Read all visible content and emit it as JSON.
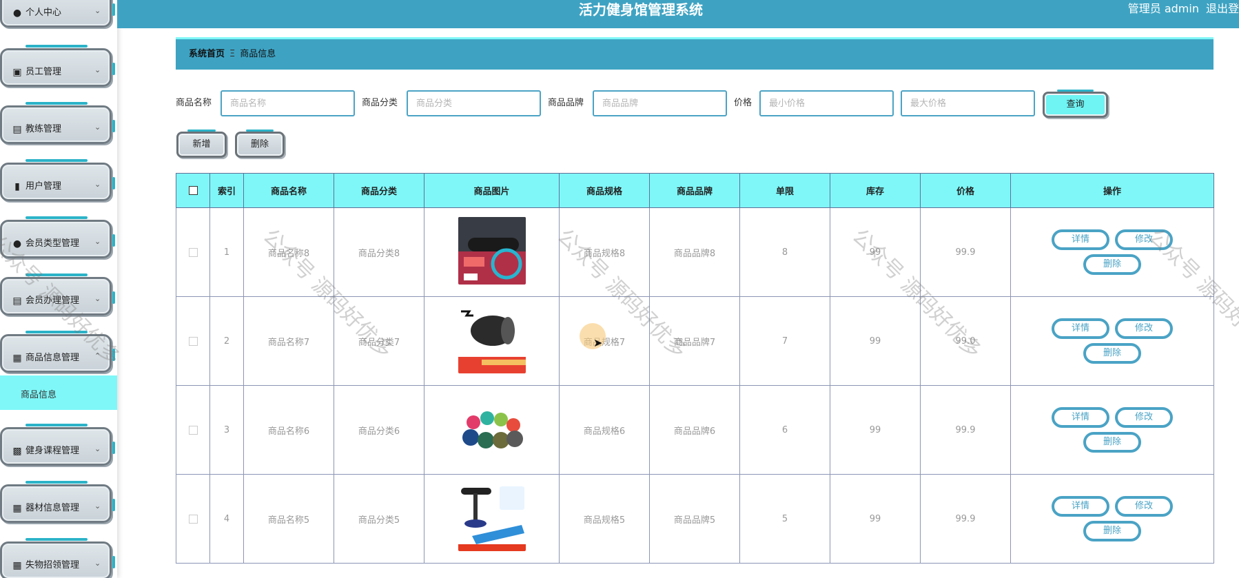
{
  "header": {
    "title": "活力健身馆管理系统",
    "user_label": "管理员 admin",
    "logout_label": "退出登"
  },
  "sidebar": {
    "items": [
      {
        "label": "个人中心",
        "icon": "person-icon"
      },
      {
        "label": "员工管理",
        "icon": "inbox-icon"
      },
      {
        "label": "教练管理",
        "icon": "briefcase-icon"
      },
      {
        "label": "用户管理",
        "icon": "bar-chart-icon"
      },
      {
        "label": "会员类型管理",
        "icon": "person-icon"
      },
      {
        "label": "会员办理管理",
        "icon": "document-icon"
      },
      {
        "label": "商品信息管理",
        "icon": "grid-icon"
      },
      {
        "label": "健身课程管理",
        "icon": "monitor-icon"
      },
      {
        "label": "器材信息管理",
        "icon": "grid-icon"
      },
      {
        "label": "失物招领管理",
        "icon": "grid-icon"
      }
    ],
    "active_sub": "商品信息"
  },
  "breadcrumb": {
    "home": "系统首页",
    "current": "商品信息"
  },
  "search": {
    "name_label": "商品名称",
    "name_placeholder": "商品名称",
    "category_label": "商品分类",
    "category_placeholder": "商品分类",
    "brand_label": "商品品牌",
    "brand_placeholder": "商品品牌",
    "price_label": "价格",
    "min_placeholder": "最小价格",
    "max_placeholder": "最大价格",
    "query_label": "查询"
  },
  "toolbar": {
    "add_label": "新增",
    "delete_label": "删除"
  },
  "table": {
    "columns": [
      "索引",
      "商品名称",
      "商品分类",
      "商品图片",
      "商品规格",
      "商品品牌",
      "单限",
      "库存",
      "价格",
      "操作"
    ],
    "rows": [
      {
        "index": "1",
        "name": "商品名称8",
        "category": "商品分类8",
        "spec": "商品规格8",
        "brand": "商品品牌8",
        "limit": "8",
        "stock": "99",
        "price": "99.9"
      },
      {
        "index": "2",
        "name": "商品名称7",
        "category": "商品分类7",
        "spec": "商品规格7",
        "brand": "商品品牌7",
        "limit": "7",
        "stock": "99",
        "price": "99.0"
      },
      {
        "index": "3",
        "name": "商品名称6",
        "category": "商品分类6",
        "spec": "商品规格6",
        "brand": "商品品牌6",
        "limit": "6",
        "stock": "99",
        "price": "99.9"
      },
      {
        "index": "4",
        "name": "商品名称5",
        "category": "商品分类5",
        "spec": "商品规格5",
        "brand": "商品品牌5",
        "limit": "5",
        "stock": "99",
        "price": "99.9"
      }
    ],
    "actions": {
      "detail": "详情",
      "edit": "修改",
      "delete": "删除"
    }
  },
  "watermark": "公众号 源码好优多",
  "colors": {
    "header": "#3ea3c3",
    "accent": "#7ff7f8",
    "button_border": "#4aa3c5"
  }
}
